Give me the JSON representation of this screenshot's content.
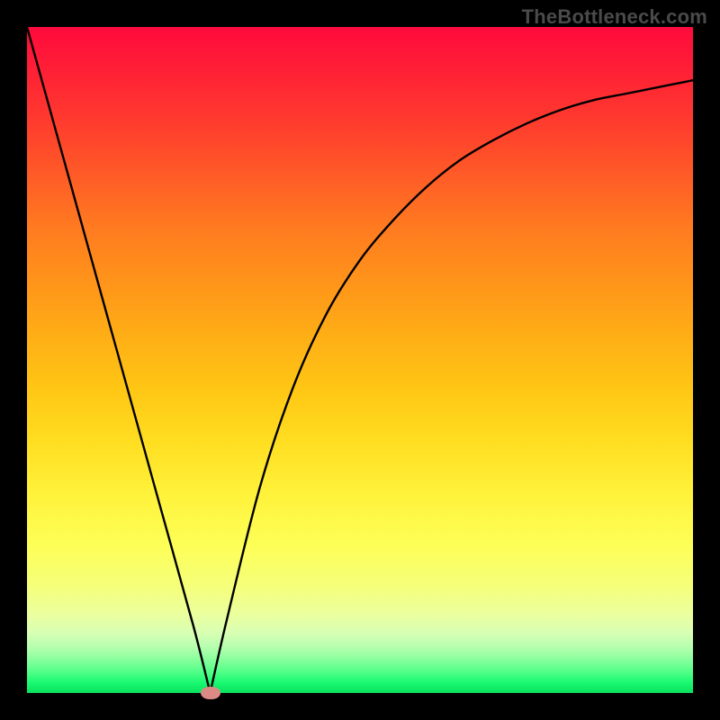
{
  "watermark": "TheBottleneck.com",
  "colors": {
    "frame": "#000000",
    "curve": "#000000",
    "marker": "#dd8a86"
  },
  "chart_data": {
    "type": "line",
    "title": "",
    "xlabel": "",
    "ylabel": "",
    "xlim": [
      0,
      100
    ],
    "ylim": [
      0,
      100
    ],
    "grid": false,
    "series": [
      {
        "name": "bottleneck-curve",
        "x": [
          0,
          5,
          10,
          15,
          20,
          25,
          27.5,
          30,
          35,
          40,
          45,
          50,
          55,
          60,
          65,
          70,
          75,
          80,
          85,
          90,
          95,
          100
        ],
        "values": [
          100,
          82,
          64,
          46,
          28,
          10,
          0,
          11,
          31,
          46,
          57,
          65,
          71,
          76,
          80,
          83,
          85.5,
          87.5,
          89,
          90,
          91,
          92
        ]
      }
    ],
    "annotations": [
      {
        "name": "minimum-marker",
        "x": 27.5,
        "y": 0
      }
    ],
    "background_gradient": {
      "type": "vertical",
      "top": "#ff0a3c",
      "bottom": "#0be05d"
    }
  }
}
